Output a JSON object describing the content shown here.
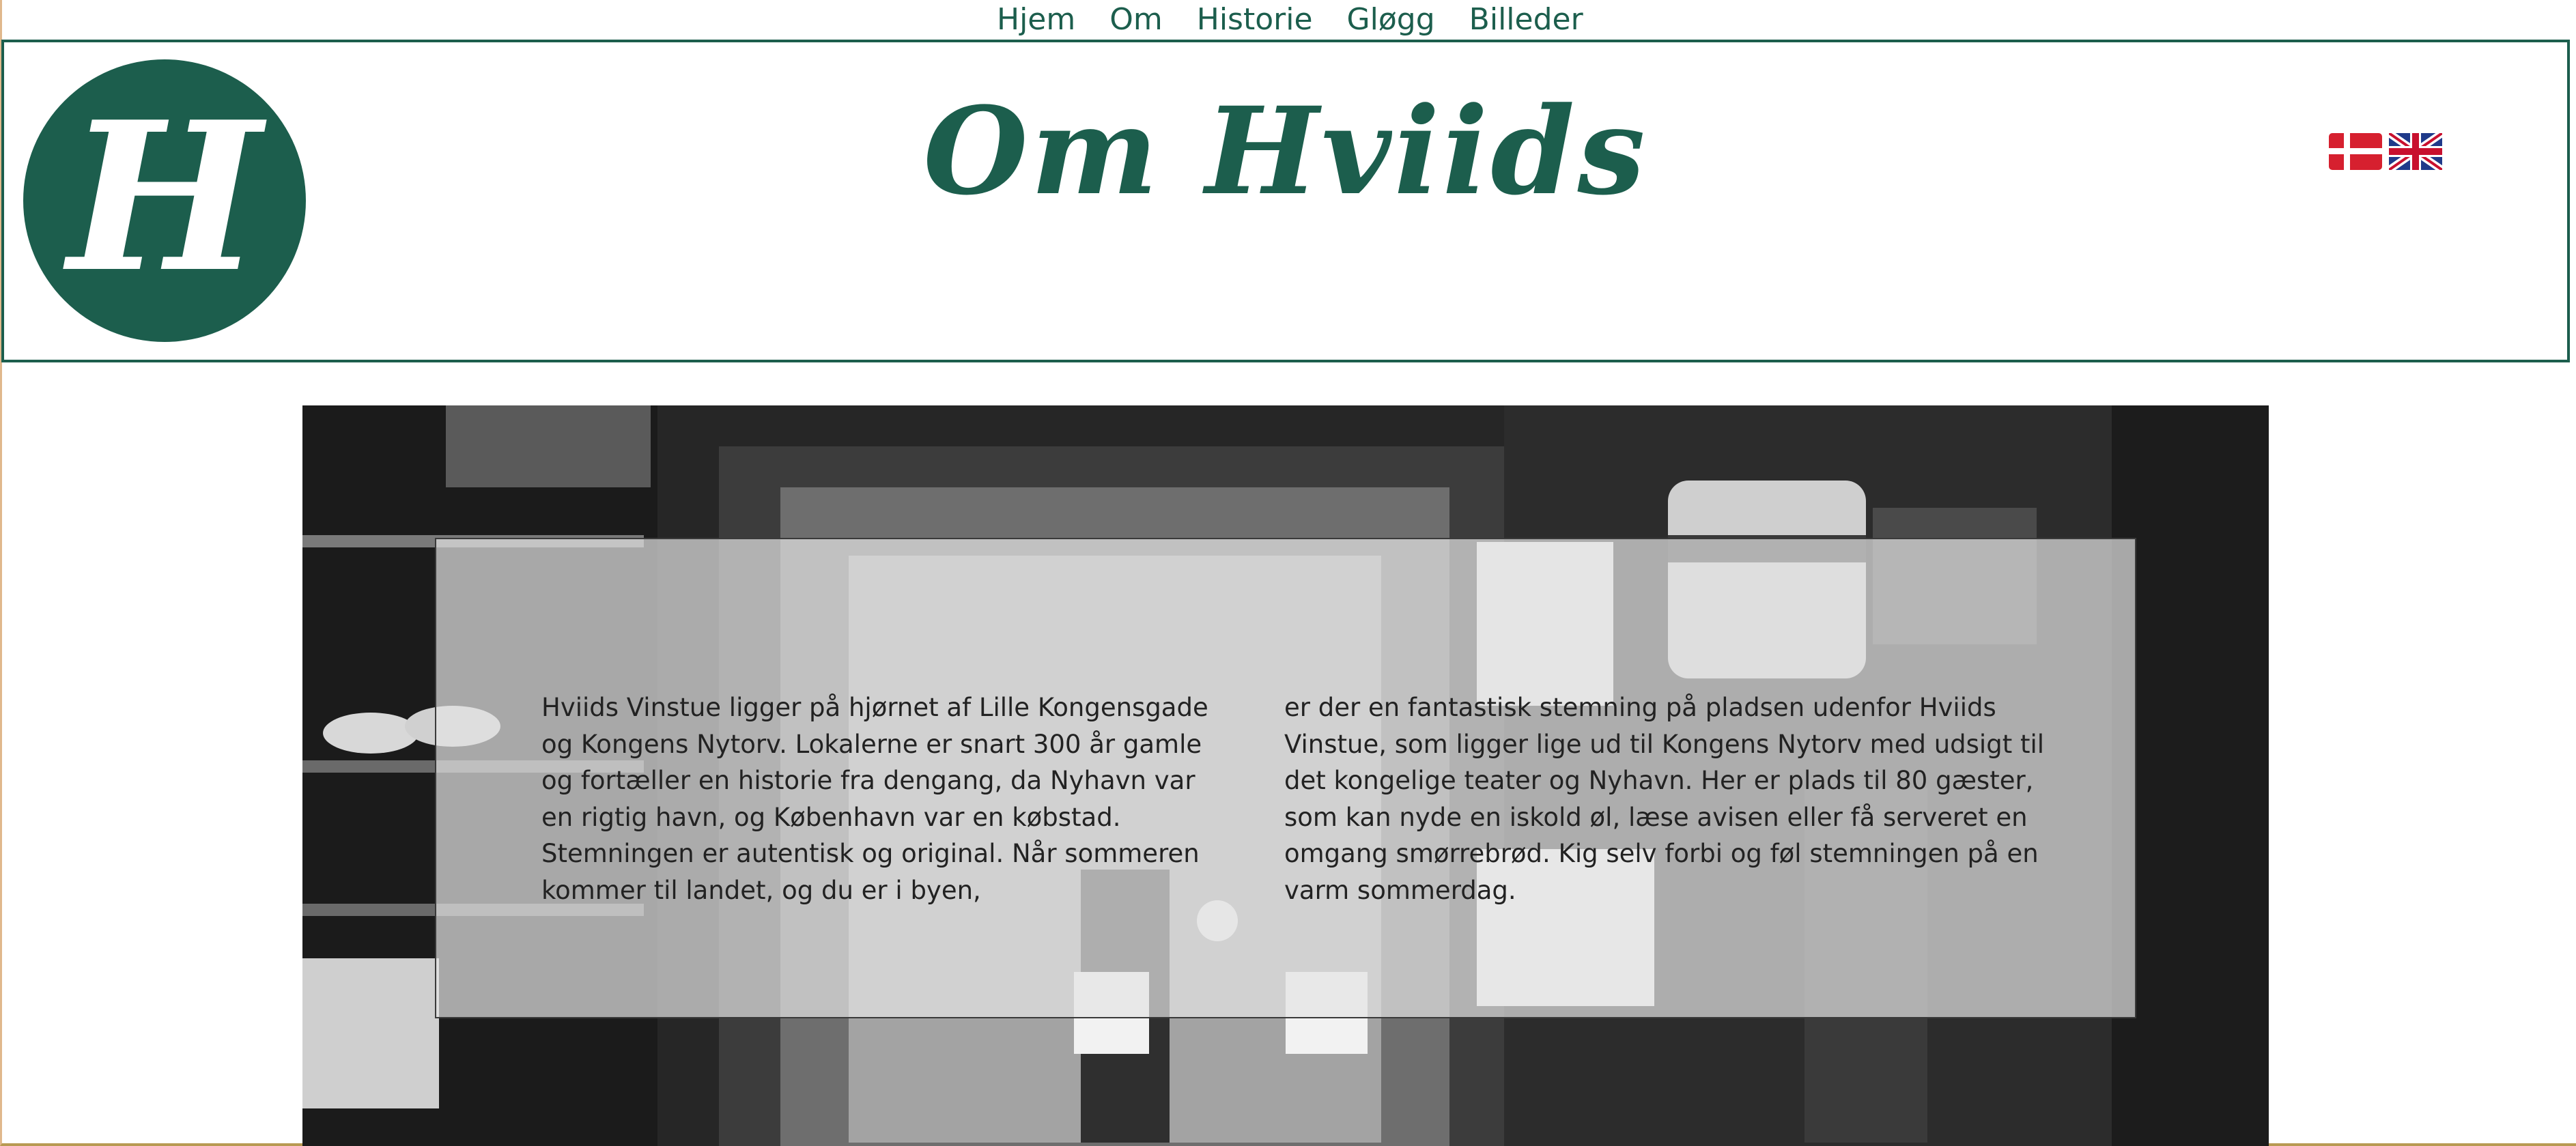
{
  "nav": {
    "items": [
      {
        "label": "Hjem"
      },
      {
        "label": "Om"
      },
      {
        "label": "Historie"
      },
      {
        "label": "Gløgg"
      },
      {
        "label": "Billeder"
      }
    ]
  },
  "header": {
    "logo_letter": "H",
    "title": "Om Hviids",
    "languages": [
      {
        "name": "danish-flag-icon"
      },
      {
        "name": "uk-flag-icon"
      }
    ]
  },
  "content": {
    "column_left": "Hviids Vinstue ligger på hjørnet af Lille Kongensgade og Kongens Nytorv. Lokalerne er snart 300 år gamle og fortæller en historie fra dengang, da Nyhavn var en rigtig havn, og København var en købstad. Stemningen er autentisk og original. Når sommeren kommer til landet, og du er i byen,",
    "column_right": "er der en fantastisk stemning på pladsen udenfor Hviids Vinstue, som ligger lige ud til Kongens Nytorv med udsigt til det kongelige teater og Nyhavn. Her er plads til 80 gæster, som kan nyde en iskold øl, læse avisen eller få serveret en omgang smørrebrød. Kig selv forbi og føl stemningen på en varm sommerdag."
  },
  "colors": {
    "brand_green": "#1c5e4d",
    "box_overlay": "rgba(228,228,228,0.70)"
  }
}
